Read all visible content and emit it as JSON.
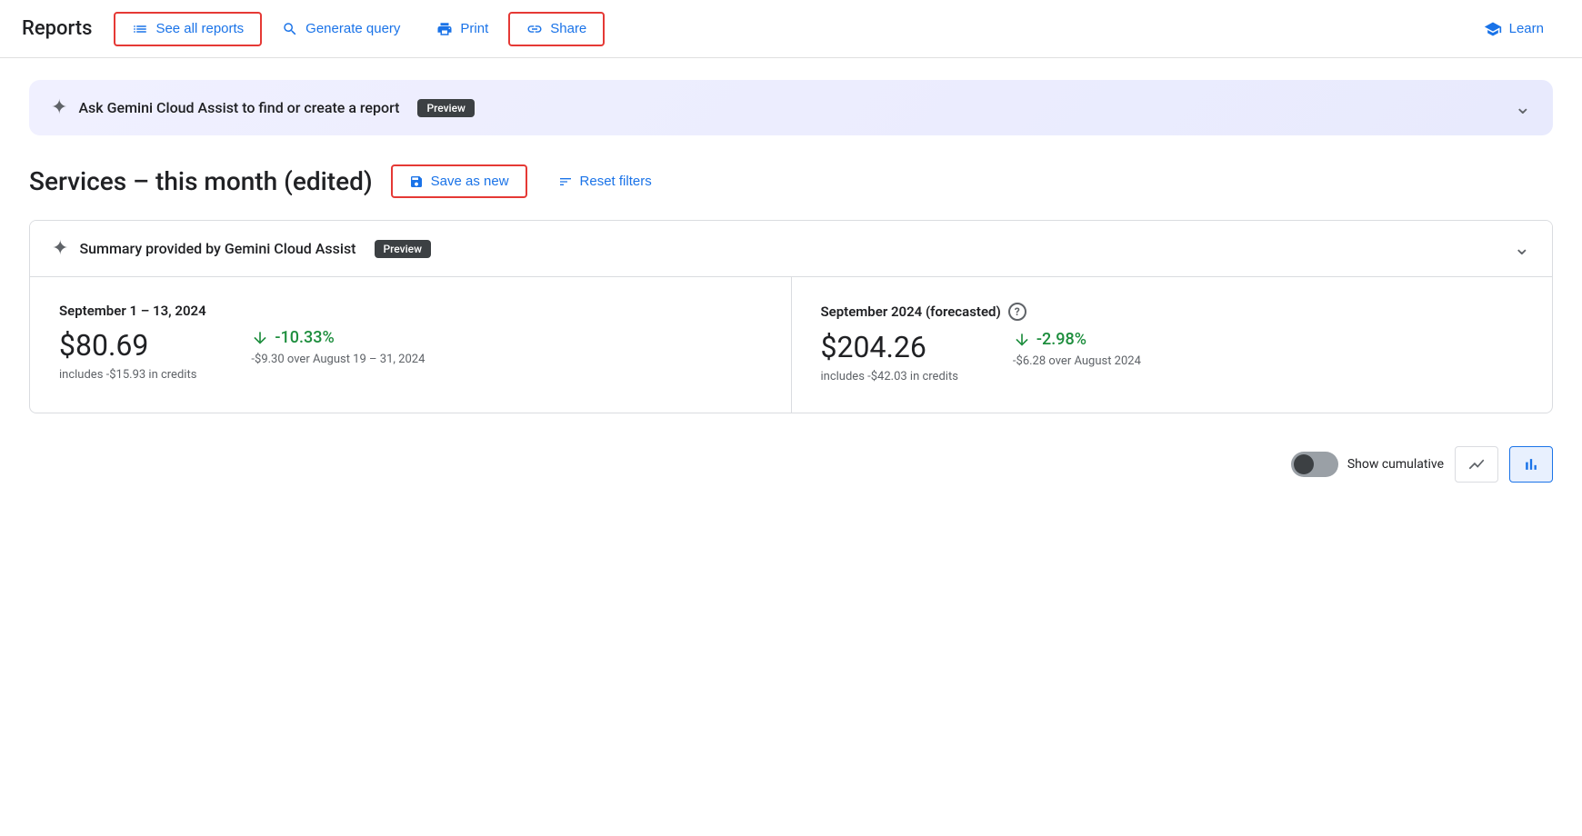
{
  "app": {
    "title": "Reports"
  },
  "nav": {
    "see_all_reports": "See all reports",
    "generate_query": "Generate query",
    "print": "Print",
    "share": "Share",
    "learn": "Learn"
  },
  "gemini_banner": {
    "text": "Ask Gemini Cloud Assist to find or create a report",
    "badge": "Preview"
  },
  "report": {
    "title": "Services – this month (edited)",
    "save_as_new": "Save as new",
    "reset_filters": "Reset filters"
  },
  "summary_card": {
    "header": "Summary provided by Gemini Cloud Assist",
    "badge": "Preview",
    "period1": {
      "label": "September 1 – 13, 2024",
      "amount": "$80.69",
      "change_pct": "-10.33%",
      "credits": "includes -$15.93 in credits",
      "comparison": "-$9.30 over August 19 – 31, 2024"
    },
    "period2": {
      "label": "September 2024 (forecasted)",
      "amount": "$204.26",
      "change_pct": "-2.98%",
      "credits": "includes -$42.03 in credits",
      "comparison": "-$6.28 over August 2024"
    }
  },
  "bottom_toolbar": {
    "show_cumulative": "Show cumulative"
  },
  "icons": {
    "list": "☰",
    "query": "⊙",
    "print": "⊟",
    "share": "⇗",
    "learn": "◈",
    "save": "⊡",
    "filter": "☰",
    "sparkle": "✦",
    "chevron": "∨",
    "arrow_down": "↓",
    "info": "?",
    "line_chart": "∕",
    "bar_chart": "▐"
  }
}
